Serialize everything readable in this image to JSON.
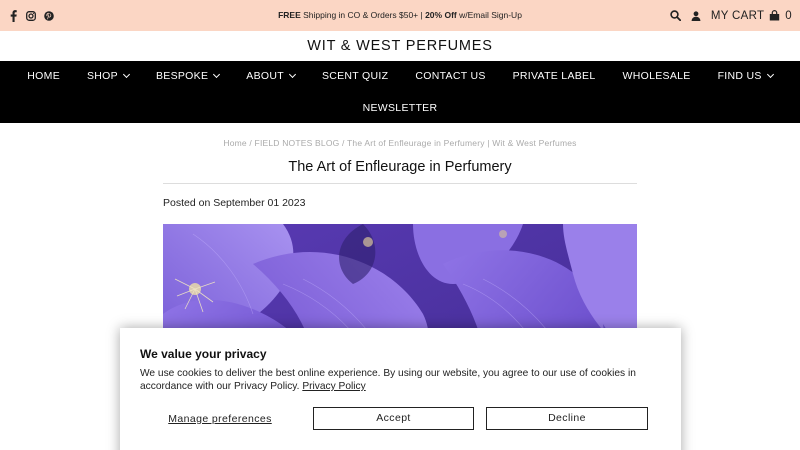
{
  "announcement": {
    "free": "FREE",
    "shipping_text": " Shipping in CO & Orders $50+ | ",
    "discount": "20% Off",
    "signup_text": " w/Email Sign-Up"
  },
  "social_icons": [
    "facebook-icon",
    "instagram-icon",
    "pinterest-icon"
  ],
  "utility": {
    "cart_label": "MY CART",
    "cart_count": "0",
    "icons": [
      "search-icon",
      "user-icon",
      "cart-icon"
    ]
  },
  "logo": "WIT & WEST PERFUMES",
  "nav": {
    "row1": [
      {
        "label": "HOME",
        "dropdown": false
      },
      {
        "label": "SHOP",
        "dropdown": true
      },
      {
        "label": "BESPOKE",
        "dropdown": true
      },
      {
        "label": "ABOUT",
        "dropdown": true
      },
      {
        "label": "SCENT QUIZ",
        "dropdown": false
      },
      {
        "label": "CONTACT US",
        "dropdown": false
      },
      {
        "label": "PRIVATE LABEL",
        "dropdown": false
      },
      {
        "label": "WHOLESALE",
        "dropdown": false
      },
      {
        "label": "FIND US",
        "dropdown": true
      }
    ],
    "row2": [
      {
        "label": "NEWSLETTER",
        "dropdown": false
      }
    ]
  },
  "breadcrumb": {
    "home": "Home",
    "sep": " / ",
    "blog": "FIELD NOTES BLOG",
    "current": "The Art of Enfleurage in Perfumery | Wit & West Perfumes"
  },
  "article": {
    "title": "The Art of Enfleurage in Perfumery",
    "posted": "Posted on September 01 2023"
  },
  "cookie": {
    "heading": "We value your privacy",
    "body": "We use cookies to deliver the best online experience. By using our website, you agree to our use of cookies in accordance with our Privacy Policy. ",
    "policy_link": "Privacy Policy",
    "manage": "Manage preferences",
    "accept": "Accept",
    "decline": "Decline"
  },
  "colors": {
    "announcement_bg": "#fbd6c4",
    "nav_bg": "#000000",
    "hero_purple": "#6a4ac4"
  }
}
